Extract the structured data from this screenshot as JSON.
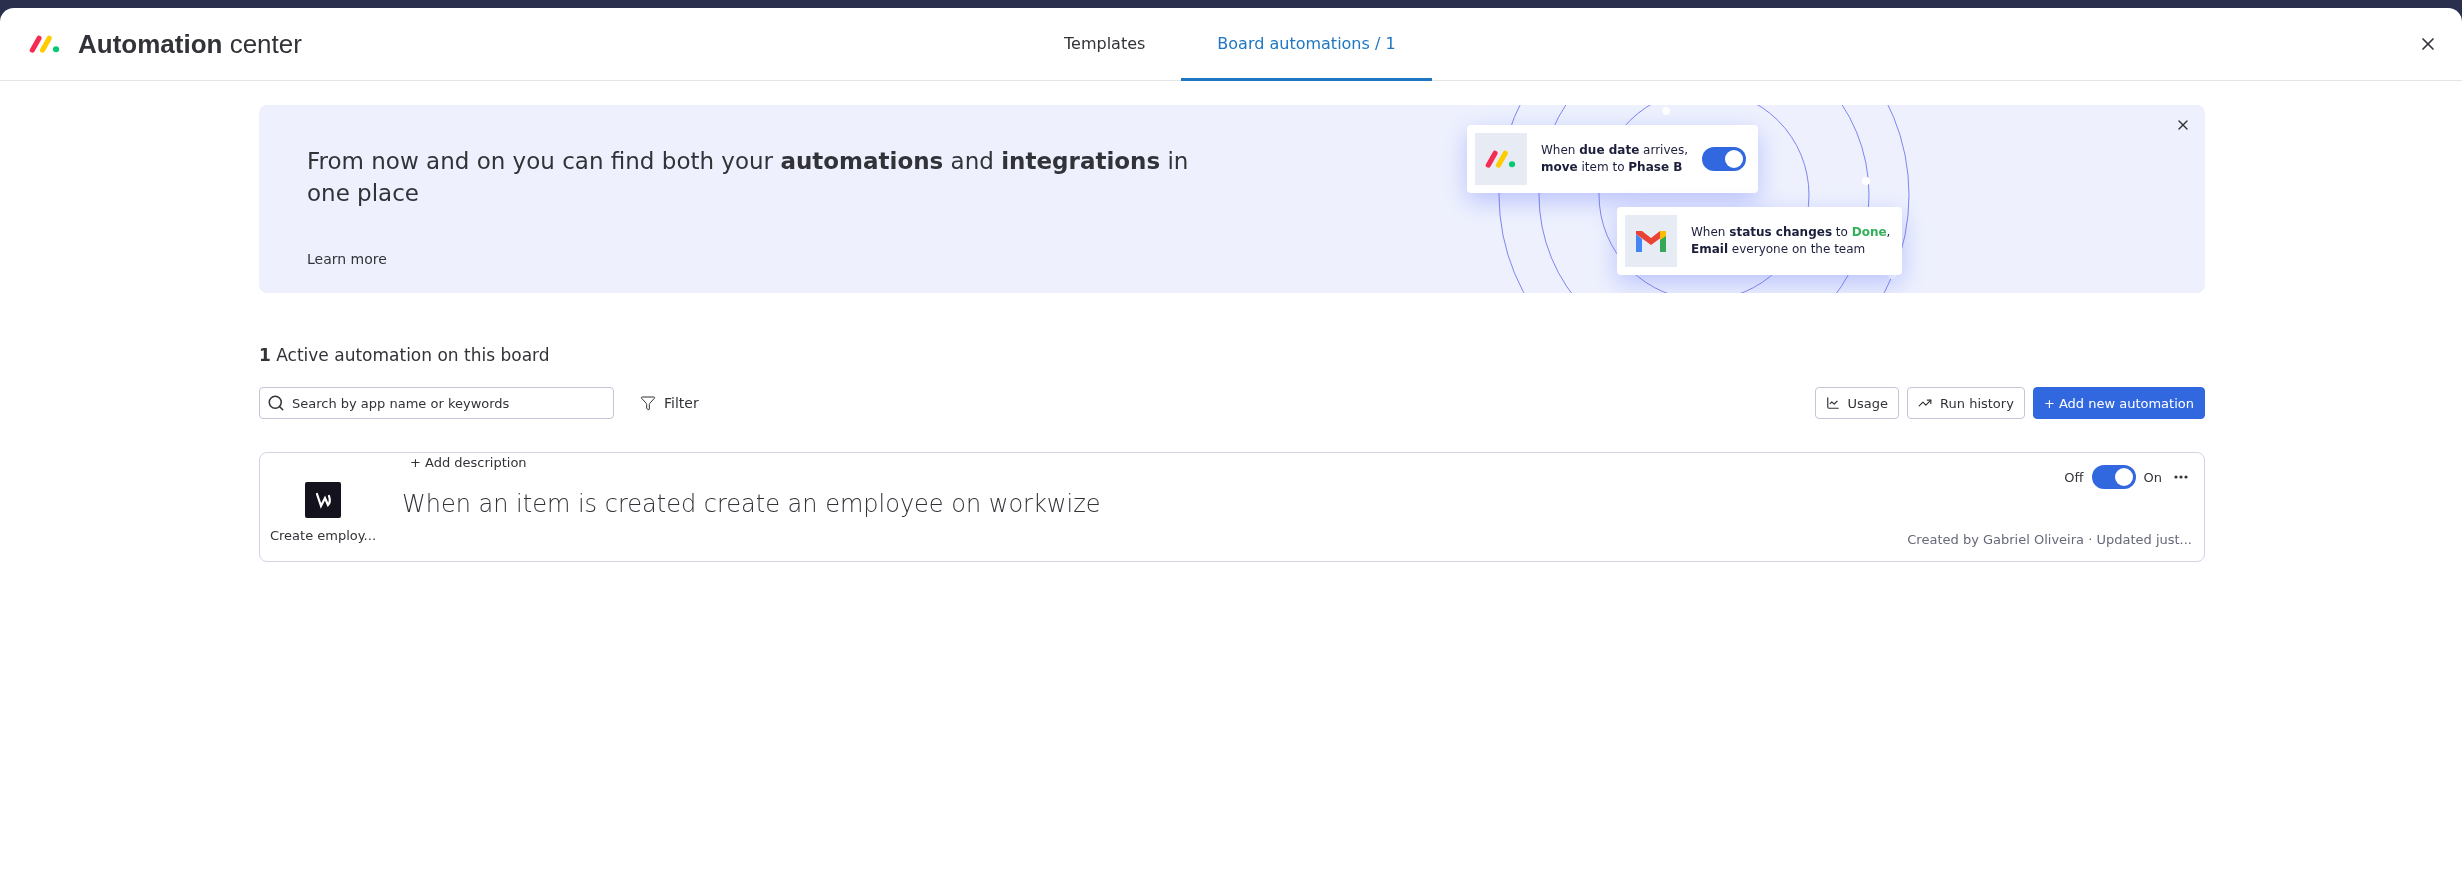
{
  "header": {
    "title_bold": "Automation",
    "title_rest": "center",
    "tabs": [
      {
        "label": "Templates",
        "selected": false
      },
      {
        "label": "Board automations / 1",
        "selected": true
      }
    ]
  },
  "banner": {
    "headline": "From now and on you can find both your **automations** and **integrations** in one place",
    "link": "Learn more",
    "cards": [
      {
        "kind": "board",
        "toggle_on": true,
        "lines": [
          {
            "text": "When **due date** arrives,"
          },
          {
            "text": "**move** item to **Phase B**"
          }
        ]
      },
      {
        "kind": "mail",
        "toggle_on": false,
        "lines": [
          {
            "text": "When **status changes** to ",
            "highlight": "Done",
            "tail": ","
          },
          {
            "text": "**Email** everyone on the team"
          }
        ]
      }
    ]
  },
  "section_title": "**1** Active automation on this board",
  "toolbar": {
    "search_placeholder": "Search by app name or keywords",
    "filter": "Filter",
    "buttons": [
      {
        "kind": "usage",
        "label": "Usage"
      },
      {
        "kind": "history",
        "label": "Run history"
      },
      {
        "kind": "primary",
        "label": "+ Add new automation"
      }
    ]
  },
  "automations": [
    {
      "app_label": "Create employ...",
      "add_description": "+ Add description",
      "title": "When an item is created create an employee on workwize",
      "off_label": "Off",
      "on_label": "On",
      "on": true,
      "footer": "Created by Gabriel Oliveira · Updated just..."
    }
  ]
}
